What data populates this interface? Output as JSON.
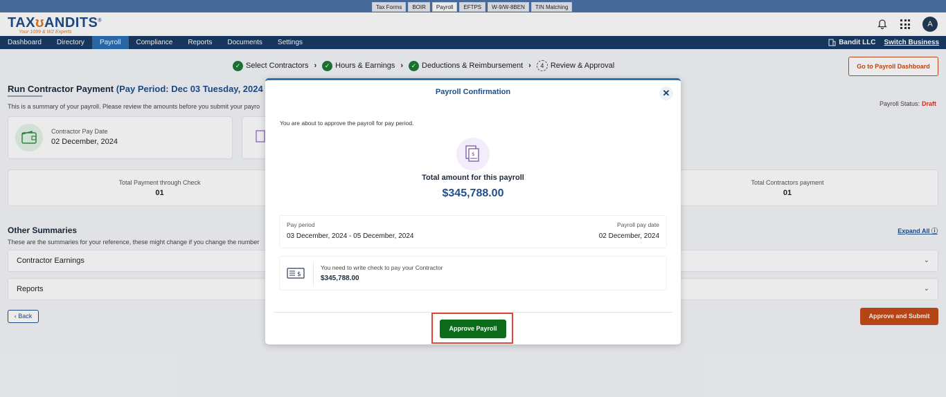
{
  "product_tabs": [
    "Tax Forms",
    "BOIR",
    "Payroll",
    "EFTPS",
    "W-9/W-8BEN",
    "TIN Matching"
  ],
  "active_product_tab": "Payroll",
  "logo": {
    "text_1": "TAX",
    "text_2": "ANDITS",
    "tagline": "Your 1099 & W2 Experts"
  },
  "avatar_initial": "A",
  "nav": {
    "items": [
      "Dashboard",
      "Directory",
      "Payroll",
      "Compliance",
      "Reports",
      "Documents",
      "Settings"
    ],
    "active": "Payroll",
    "business_name": "Bandit LLC",
    "switch_label": "Switch Business"
  },
  "steps": [
    {
      "label": "Select Contractors",
      "done": true
    },
    {
      "label": "Hours & Earnings",
      "done": true
    },
    {
      "label": "Deductions & Reimbursement",
      "done": true
    },
    {
      "label": "Review & Approval",
      "done": false,
      "number": "4"
    }
  ],
  "dashboard_button": "Go to Payroll Dashboard",
  "page": {
    "title": "Run Contractor Payment",
    "period": "(Pay Period: Dec 03 Tuesday, 2024 - Dec 0",
    "subtitle": "This is a summary of your payroll. Please review the amounts before you submit your payro",
    "status_label": "Payroll Status:",
    "status_value": "Draft"
  },
  "summary": {
    "pay_date_label": "Contractor Pay Date",
    "pay_date_value": "02 December, 2024",
    "check_payment_label": "Total Payment through Check",
    "check_payment_value": "01",
    "contractors_payment_label": "Total Contractors payment",
    "contractors_payment_value": "01"
  },
  "other_summaries": {
    "title": "Other Summaries",
    "subtitle": "These are the summaries for your reference, these might change if you change the number",
    "expand_all": "Expand All",
    "sections": [
      "Contractor Earnings",
      "Reports"
    ]
  },
  "buttons": {
    "back": "Back",
    "approve_submit": "Approve and Submit"
  },
  "modal": {
    "title": "Payroll Confirmation",
    "close": "✕",
    "intro": "You are about to approve the payroll for pay period.",
    "total_label": "Total amount for this payroll",
    "total_value": "$345,788.00",
    "pay_period_label": "Pay period",
    "pay_period_value": "03 December, 2024 - 05 December, 2024",
    "pay_date_label": "Payroll pay date",
    "pay_date_value": "02 December, 2024",
    "check_note": "You need to write check to pay your Contractor",
    "check_amount": "$345,788.00",
    "approve_button": "Approve Payroll"
  },
  "colors": {
    "brand": "#1f4e8c",
    "nav": "#183b66",
    "accent": "#c54b1a",
    "approve": "#0d6b1c",
    "highlight": "#e0453a"
  }
}
